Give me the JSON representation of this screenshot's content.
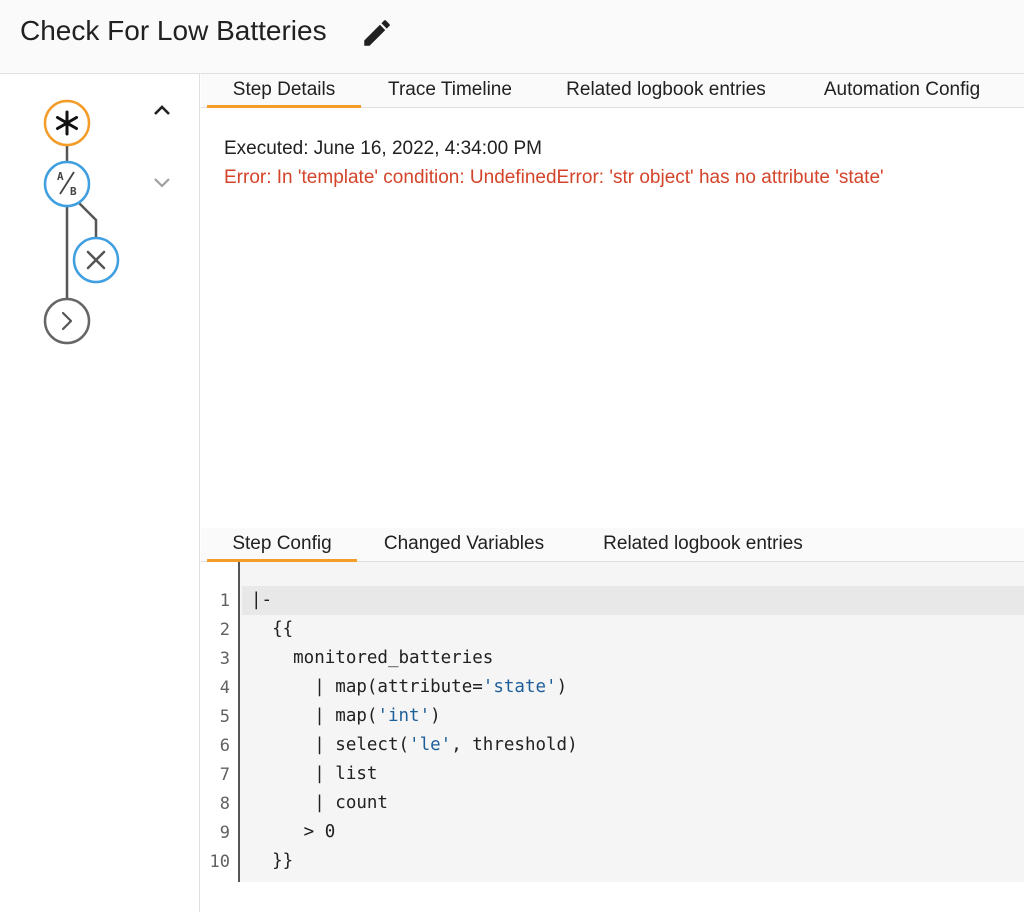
{
  "header": {
    "title": "Check For Low Batteries",
    "edit_icon": "pencil-icon"
  },
  "colors": {
    "accent": "#f39c28",
    "node_blue": "#3f9fe0",
    "node_grey": "#555555",
    "error": "#d4442a",
    "string": "#1f5f99"
  },
  "graph": {
    "nodes": [
      {
        "name": "trigger-node",
        "icon": "asterisk-icon"
      },
      {
        "name": "condition-node",
        "icon": "ab-condition-icon",
        "glyph_a": "A",
        "glyph_b": "B"
      },
      {
        "name": "stop-node",
        "icon": "close-icon"
      },
      {
        "name": "action-node",
        "icon": "chevron-right-icon"
      }
    ],
    "nav": {
      "up_icon": "chevron-up-icon",
      "down_icon": "chevron-down-icon"
    }
  },
  "top_tabs": [
    {
      "label": "Step Details",
      "active": true
    },
    {
      "label": "Trace Timeline",
      "active": false
    },
    {
      "label": "Related logbook entries",
      "active": false
    },
    {
      "label": "Automation Config",
      "active": false
    }
  ],
  "details": {
    "executed": "Executed: June 16, 2022, 4:34:00 PM",
    "error": "Error: In 'template' condition: UndefinedError: 'str object' has no attribute 'state'"
  },
  "bottom_tabs": [
    {
      "label": "Step Config",
      "active": true
    },
    {
      "label": "Changed Variables",
      "active": false
    },
    {
      "label": "Related logbook entries",
      "active": false
    }
  ],
  "code": {
    "line_numbers": [
      "1",
      "2",
      "3",
      "4",
      "5",
      "6",
      "7",
      "8",
      "9",
      "10"
    ],
    "lines": [
      [
        {
          "t": "|-"
        }
      ],
      [
        {
          "t": "  {{"
        }
      ],
      [
        {
          "t": "    monitored_batteries"
        }
      ],
      [
        {
          "t": "      | map(attribute="
        },
        {
          "t": "'state'",
          "s": 1
        },
        {
          "t": ")"
        }
      ],
      [
        {
          "t": "      | map("
        },
        {
          "t": "'int'",
          "s": 1
        },
        {
          "t": ")"
        }
      ],
      [
        {
          "t": "      | select("
        },
        {
          "t": "'le'",
          "s": 1
        },
        {
          "t": ", threshold)"
        }
      ],
      [
        {
          "t": "      | list"
        }
      ],
      [
        {
          "t": "      | count"
        }
      ],
      [
        {
          "t": "     > 0"
        }
      ],
      [
        {
          "t": "  }}"
        }
      ]
    ]
  }
}
